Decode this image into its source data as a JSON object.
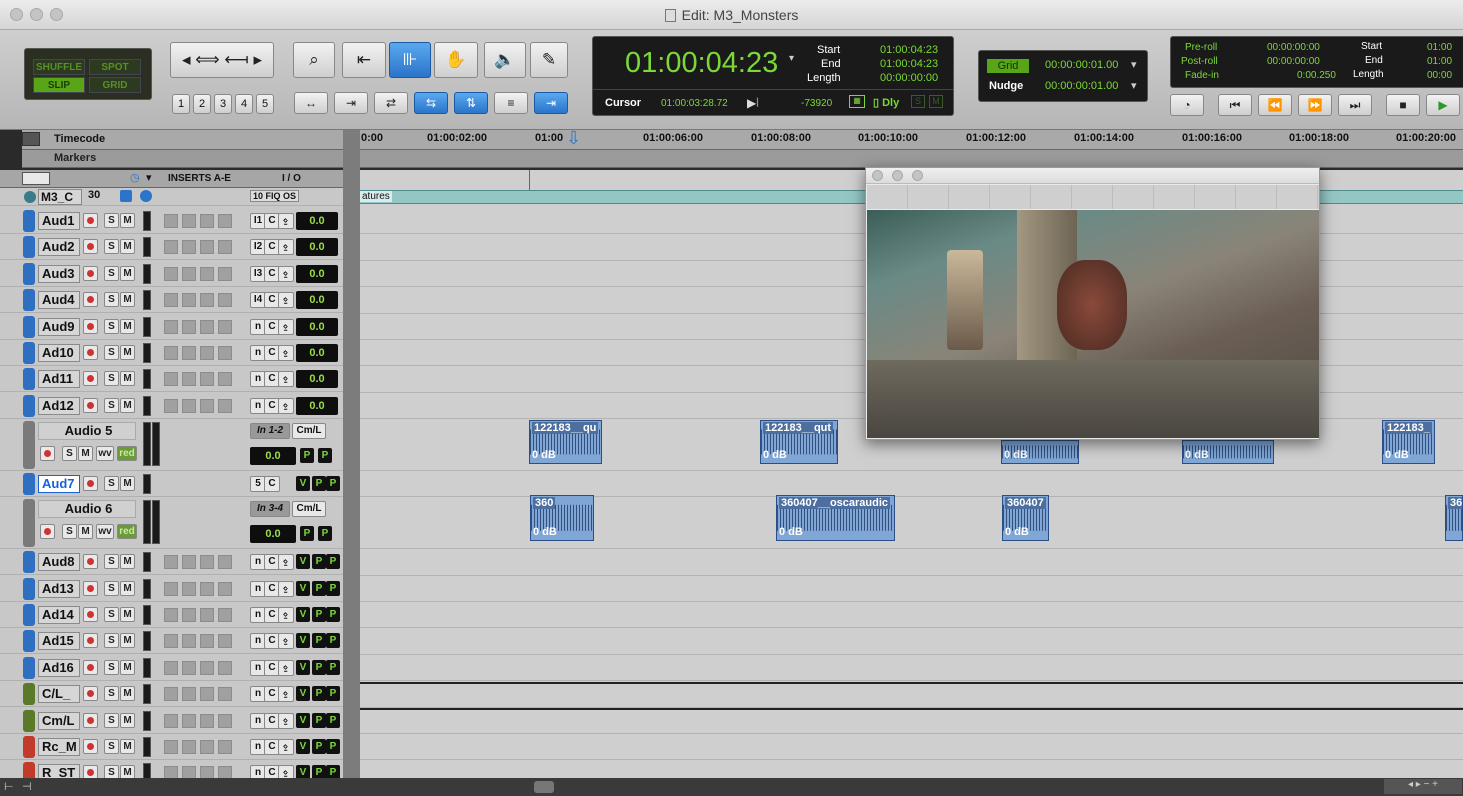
{
  "window": {
    "title": "Edit: M3_Monsters"
  },
  "toolbar": {
    "modes": [
      "SHUFFLE",
      "SPOT",
      "SLIP",
      "GRID"
    ],
    "zoom_presets": [
      "1",
      "2",
      "3",
      "4",
      "5"
    ],
    "counter": {
      "main": "01:00:04:23",
      "start_label": "Start",
      "start": "01:00:04:23",
      "end_label": "End",
      "end": "01:00:04:23",
      "length_label": "Length",
      "length": "00:00:00:00",
      "cursor_label": "Cursor",
      "cursor": "01:00:03:28.72",
      "cursor_value": "-73920",
      "dly": "Dly"
    },
    "grid": {
      "label": "Grid",
      "value": "00:00:00:01.00",
      "nudge_label": "Nudge",
      "nudge": "00:00:00:01.00"
    },
    "transport": {
      "preroll_label": "Pre-roll",
      "preroll": "00:00:00:00",
      "postroll_label": "Post-roll",
      "postroll": "00:00:00:00",
      "fadein_label": "Fade-in",
      "fadein": "0:00.250",
      "start_label": "Start",
      "start": "01:00",
      "end_label": "End",
      "end": "01:00",
      "length_label": "Length",
      "length": "00:00"
    }
  },
  "ruler": {
    "label": "Timecode",
    "markers_label": "Markers",
    "ticks": [
      "0:00",
      "01:00:02:00",
      "01:00",
      "01:00:06:00",
      "01:00:08:00",
      "01:00:10:00",
      "01:00:12:00",
      "01:00:14:00",
      "01:00:16:00",
      "01:00:18:00",
      "01:00:20:00"
    ]
  },
  "columns": {
    "inserts": "INSERTS A-E",
    "io": "I / O"
  },
  "video_track": {
    "name": "M3_C",
    "fps": "30",
    "clip": "atures"
  },
  "tracks": [
    {
      "name": "Aud1",
      "vol": "0.0",
      "io": "I1"
    },
    {
      "name": "Aud2",
      "vol": "0.0",
      "io": "I2"
    },
    {
      "name": "Aud3",
      "vol": "0.0",
      "io": "I3"
    },
    {
      "name": "Aud4",
      "vol": "0.0",
      "io": "I4"
    },
    {
      "name": "Aud9",
      "vol": "0.0",
      "io": "n"
    },
    {
      "name": "Ad10",
      "vol": "0.0",
      "io": "n"
    },
    {
      "name": "Ad11",
      "vol": "0.0",
      "io": "n"
    },
    {
      "name": "Ad12",
      "vol": "0.0",
      "io": "n"
    }
  ],
  "big_tracks": [
    {
      "name": "Audio 5",
      "input": "In 1-2",
      "output": "Cm/L",
      "vol": "0.0",
      "wv": "wv",
      "red": "red"
    },
    {
      "name": "Audio 6",
      "input": "In 3-4",
      "output": "Cm/L",
      "vol": "0.0",
      "wv": "wv",
      "red": "red"
    }
  ],
  "aud7": {
    "name": "Aud7"
  },
  "lower_tracks": [
    "Aud8",
    "Ad13",
    "Ad14",
    "Ad15",
    "Ad16",
    "C/L_",
    "Cm/L",
    "Rc_M",
    "R_ST"
  ],
  "clips": [
    {
      "name": "122183__qu",
      "gain": "0 dB"
    },
    {
      "name": "122183__qut",
      "gain": "0 dB"
    },
    {
      "name": "",
      "gain": "0 dB"
    },
    {
      "name": "",
      "gain": "0 dB"
    },
    {
      "name": "122183_",
      "gain": "0 dB"
    },
    {
      "name": "360",
      "gain": "0 dB"
    },
    {
      "name": "360407__oscaraudic",
      "gain": "0 dB"
    },
    {
      "name": "360407",
      "gain": "0 dB"
    },
    {
      "name": "36",
      "gain": ""
    }
  ],
  "colors": {
    "accent": "#2a74c9",
    "counter_green": "#7cd838",
    "clip_blue": "#7fa6d4"
  }
}
